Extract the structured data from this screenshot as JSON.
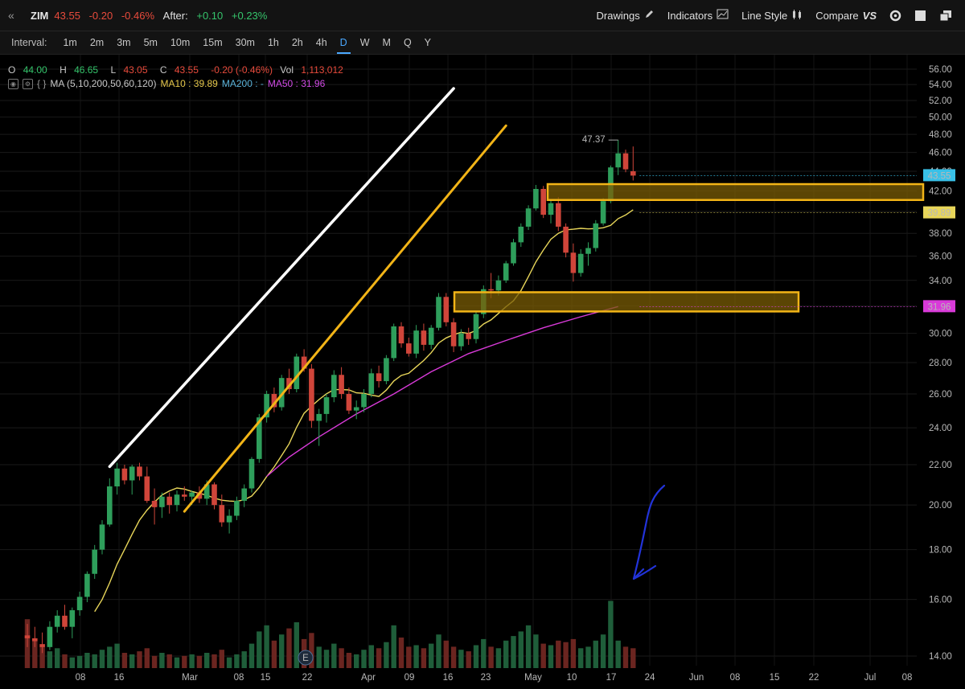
{
  "header": {
    "symbol": "ZIM",
    "last": "43.55",
    "change": "-0.20",
    "change_pct": "-0.46%",
    "after_label": "After:",
    "after_change": "+0.10",
    "after_pct": "+0.23%",
    "collapse_icon": "double-chevron-left-icon"
  },
  "toolbar": {
    "drawings": "Drawings",
    "indicators": "Indicators",
    "line_style": "Line Style",
    "compare": "Compare",
    "compare_badge": "VS"
  },
  "intervals": {
    "label": "Interval:",
    "items": [
      "1m",
      "2m",
      "3m",
      "5m",
      "10m",
      "15m",
      "30m",
      "1h",
      "2h",
      "4h",
      "D",
      "W",
      "M",
      "Q",
      "Y"
    ],
    "active": "D"
  },
  "ohlc": {
    "o_label": "O",
    "o": "44.00",
    "h_label": "H",
    "h": "46.65",
    "l_label": "L",
    "l": "43.05",
    "c_label": "C",
    "c": "43.55",
    "chg": "-0.20 (-0.46%)",
    "vol_label": "Vol",
    "vol": "1,113,012"
  },
  "ma_legend": {
    "name": "MA (5,10,200,50,60,120)",
    "ma10": "MA10 : 39.89",
    "ma200": "MA200 : -",
    "ma50": "MA50 : 31.96"
  },
  "colors": {
    "up": "#2e9e5b",
    "down": "#d0453a",
    "ma10": "#e8d65a",
    "ma50": "#d93ad9",
    "trend": "#f2b417",
    "resistance": "#ffffff",
    "zone_fill": "#7a5c06",
    "price_tag": "#39c1e8",
    "annotation": "#2233d9"
  },
  "chart_data": {
    "type": "candlestick",
    "symbol": "ZIM",
    "x_ticks": [
      "08",
      "16",
      "Mar",
      "08",
      "15",
      "22",
      "Apr",
      "09",
      "16",
      "23",
      "May",
      "10",
      "17",
      "24",
      "Jun",
      "08",
      "15",
      "22",
      "Jul",
      "08"
    ],
    "y_ticks": [
      "56.00",
      "54.00",
      "52.00",
      "50.00",
      "48.00",
      "46.00",
      "44.00",
      "42.00",
      "40.00",
      "38.00",
      "36.00",
      "34.00",
      "32.00",
      "30.00",
      "28.00",
      "26.00",
      "24.00",
      "22.00",
      "20.00",
      "18.00",
      "16.00",
      "14.00"
    ],
    "y_range": [
      13.5,
      57
    ],
    "price_labels": {
      "last": "43.55",
      "ma10": "39.89",
      "ma50": "31.96",
      "high_marker": "47.37"
    },
    "earnings_marker": "E",
    "candles": [
      [
        14.7,
        15.1,
        14.3,
        14.6
      ],
      [
        14.6,
        15.0,
        14.3,
        14.5
      ],
      [
        14.4,
        14.8,
        14.1,
        14.3
      ],
      [
        14.3,
        15.2,
        14.2,
        15.0
      ],
      [
        15.0,
        15.6,
        14.8,
        15.4
      ],
      [
        15.4,
        15.8,
        14.9,
        15.0
      ],
      [
        15.0,
        15.7,
        14.6,
        15.6
      ],
      [
        15.6,
        16.3,
        15.4,
        16.1
      ],
      [
        16.1,
        17.1,
        15.9,
        17.0
      ],
      [
        17.0,
        18.2,
        16.8,
        18.0
      ],
      [
        18.0,
        19.3,
        17.8,
        19.1
      ],
      [
        19.1,
        21.3,
        19.0,
        20.9
      ],
      [
        20.9,
        22.1,
        20.5,
        21.8
      ],
      [
        21.8,
        22.0,
        21.0,
        21.2
      ],
      [
        21.2,
        22.0,
        20.5,
        21.9
      ],
      [
        21.9,
        22.1,
        21.2,
        21.4
      ],
      [
        21.4,
        21.9,
        20.1,
        20.2
      ],
      [
        20.2,
        20.8,
        19.1,
        19.9
      ],
      [
        19.9,
        20.6,
        19.4,
        20.4
      ],
      [
        20.4,
        20.6,
        19.6,
        20.0
      ],
      [
        20.0,
        20.7,
        19.7,
        20.5
      ],
      [
        20.5,
        20.9,
        20.2,
        20.4
      ],
      [
        20.4,
        20.7,
        20.0,
        20.6
      ],
      [
        20.6,
        20.9,
        20.1,
        20.3
      ],
      [
        20.3,
        21.2,
        20.0,
        21.0
      ],
      [
        21.0,
        21.1,
        19.8,
        20.0
      ],
      [
        20.0,
        20.5,
        19.0,
        19.2
      ],
      [
        19.2,
        19.8,
        18.7,
        19.5
      ],
      [
        19.5,
        20.4,
        19.3,
        20.2
      ],
      [
        20.2,
        21.0,
        19.9,
        20.8
      ],
      [
        20.8,
        22.4,
        20.6,
        22.3
      ],
      [
        22.3,
        24.8,
        22.1,
        24.6
      ],
      [
        24.6,
        26.2,
        24.3,
        26.0
      ],
      [
        26.0,
        26.4,
        24.9,
        25.2
      ],
      [
        25.2,
        27.2,
        25.0,
        27.0
      ],
      [
        27.0,
        27.6,
        26.0,
        26.3
      ],
      [
        26.3,
        28.6,
        26.1,
        28.4
      ],
      [
        28.4,
        28.9,
        27.4,
        27.6
      ],
      [
        27.6,
        27.9,
        24.0,
        24.4
      ],
      [
        24.4,
        25.1,
        23.0,
        24.8
      ],
      [
        24.8,
        26.0,
        24.3,
        25.8
      ],
      [
        25.8,
        27.5,
        25.5,
        27.2
      ],
      [
        27.2,
        27.7,
        25.7,
        26.0
      ],
      [
        26.0,
        26.4,
        24.8,
        25.0
      ],
      [
        25.0,
        25.6,
        24.5,
        25.2
      ],
      [
        25.2,
        26.3,
        24.9,
        26.0
      ],
      [
        26.0,
        27.6,
        25.8,
        27.3
      ],
      [
        27.3,
        27.8,
        26.4,
        26.8
      ],
      [
        26.8,
        28.5,
        26.6,
        28.3
      ],
      [
        28.3,
        30.7,
        28.1,
        30.5
      ],
      [
        30.5,
        30.8,
        29.0,
        29.3
      ],
      [
        29.3,
        29.7,
        28.4,
        28.6
      ],
      [
        28.6,
        30.6,
        28.3,
        30.2
      ],
      [
        30.2,
        30.7,
        28.8,
        29.2
      ],
      [
        29.2,
        30.6,
        28.9,
        30.4
      ],
      [
        30.4,
        33.0,
        30.2,
        32.7
      ],
      [
        32.7,
        33.0,
        30.5,
        30.8
      ],
      [
        30.8,
        31.1,
        28.7,
        29.1
      ],
      [
        29.1,
        30.3,
        28.8,
        30.0
      ],
      [
        30.0,
        30.4,
        29.2,
        29.6
      ],
      [
        29.6,
        31.6,
        29.3,
        31.4
      ],
      [
        31.4,
        33.6,
        31.1,
        33.3
      ],
      [
        33.3,
        34.6,
        32.6,
        33.2
      ],
      [
        33.2,
        34.4,
        32.8,
        34.0
      ],
      [
        34.0,
        35.6,
        33.8,
        35.4
      ],
      [
        35.4,
        37.5,
        35.2,
        37.2
      ],
      [
        37.2,
        38.9,
        36.8,
        38.6
      ],
      [
        38.6,
        40.6,
        38.3,
        40.3
      ],
      [
        40.3,
        42.6,
        40.1,
        42.2
      ],
      [
        42.2,
        42.5,
        39.4,
        39.7
      ],
      [
        39.7,
        41.2,
        38.9,
        40.8
      ],
      [
        40.8,
        41.4,
        38.2,
        38.6
      ],
      [
        38.6,
        38.9,
        35.9,
        36.3
      ],
      [
        36.3,
        37.1,
        33.9,
        34.6
      ],
      [
        34.6,
        36.6,
        34.3,
        36.2
      ],
      [
        36.2,
        37.2,
        35.2,
        36.7
      ],
      [
        36.7,
        39.2,
        36.4,
        38.9
      ],
      [
        38.9,
        41.3,
        38.7,
        41.0
      ],
      [
        41.0,
        44.6,
        40.8,
        44.4
      ],
      [
        44.4,
        47.37,
        43.6,
        45.9
      ],
      [
        45.9,
        46.3,
        43.9,
        44.2
      ],
      [
        44.0,
        46.65,
        43.05,
        43.55
      ]
    ],
    "volume": [
      32,
      18,
      14,
      11,
      13,
      9,
      7,
      8,
      10,
      9,
      12,
      14,
      16,
      10,
      9,
      11,
      13,
      8,
      10,
      9,
      7,
      8,
      9,
      8,
      10,
      9,
      12,
      7,
      9,
      11,
      16,
      24,
      28,
      18,
      22,
      26,
      30,
      19,
      23,
      14,
      12,
      16,
      13,
      10,
      9,
      12,
      15,
      13,
      17,
      28,
      20,
      14,
      15,
      13,
      16,
      22,
      18,
      14,
      12,
      11,
      15,
      19,
      14,
      13,
      18,
      21,
      24,
      28,
      22,
      16,
      15,
      18,
      17,
      19,
      13,
      14,
      18,
      22,
      44,
      18,
      14,
      13
    ],
    "ma10_start_index": 9,
    "ma50_points": [
      [
        32,
        21.4
      ],
      [
        35,
        22.4
      ],
      [
        39,
        23.5
      ],
      [
        44,
        24.8
      ],
      [
        49,
        26.0
      ],
      [
        54,
        27.4
      ],
      [
        59,
        28.6
      ],
      [
        64,
        29.5
      ],
      [
        69,
        30.4
      ],
      [
        74,
        31.2
      ],
      [
        79,
        31.96
      ]
    ],
    "drawings": {
      "resistance_line": [
        [
          11,
          21.9
        ],
        [
          57,
          53.5
        ]
      ],
      "support_line": [
        [
          21,
          19.7
        ],
        [
          64,
          49.0
        ]
      ],
      "zone_upper": [
        [
          47,
          42.6
        ],
        [
          79,
          41.9
        ]
      ],
      "zone_lower": [
        [
          38,
          33.0
        ],
        [
          67,
          32.2
        ]
      ]
    }
  }
}
